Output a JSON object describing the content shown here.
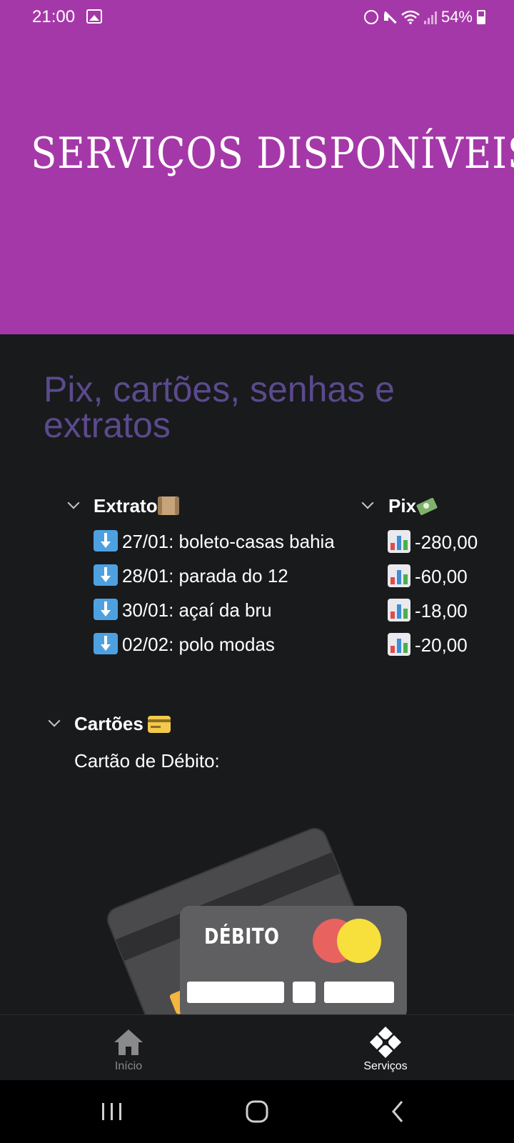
{
  "status_bar": {
    "time": "21:00",
    "battery": "54%",
    "icons": [
      "gallery-icon",
      "alarm-icon",
      "mute-icon",
      "wifi-icon",
      "signal-icon",
      "battery-icon"
    ]
  },
  "hero": {
    "title": "SERVIÇOS DISPONÍVEIS",
    "background": "#a538a8"
  },
  "content": {
    "heading": "Pix, cartões, senhas e extratos",
    "heading_color": "#5b4a8c",
    "background": "#191a1c"
  },
  "extrato": {
    "label": "Extrato",
    "rows": [
      "27/01: boleto-casas bahia",
      "28/01: parada do 12",
      "30/01: açaí da bru",
      "02/02: polo modas"
    ]
  },
  "pix": {
    "label": "Pix",
    "rows": [
      "-280,00",
      "-60,00",
      "-18,00",
      "-20,00"
    ]
  },
  "cartoes": {
    "label": "Cartões",
    "subtitle": "Cartão de Débito:",
    "card_label": "DÉBITO"
  },
  "bottom_nav": {
    "home_label": "Início",
    "services_label": "Serviços",
    "active": "services"
  }
}
